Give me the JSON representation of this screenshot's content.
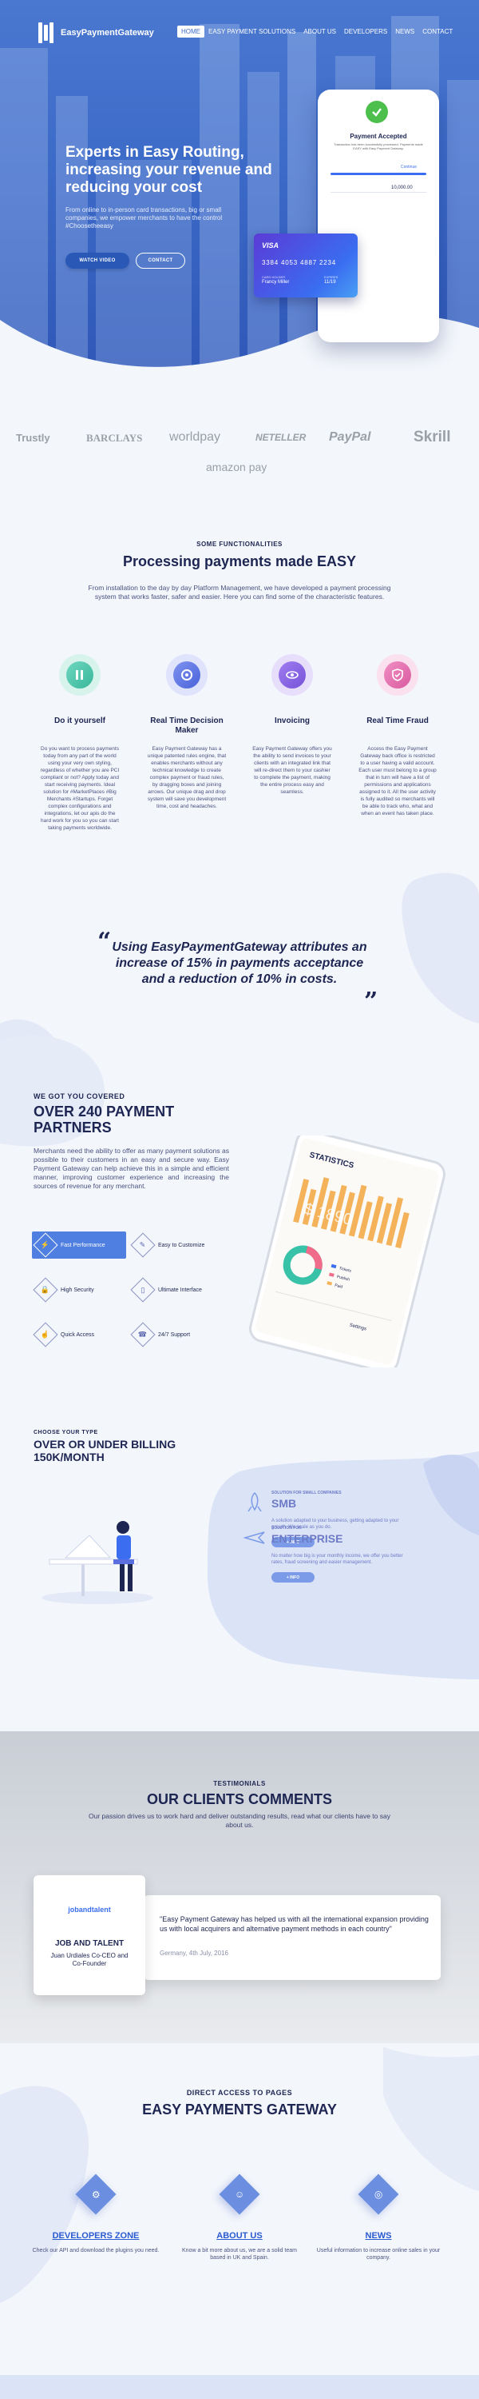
{
  "brand": {
    "name": "EasyPaymentGateway"
  },
  "nav": [
    {
      "label": "HOME",
      "active": true
    },
    {
      "label": "EASY PAYMENT SOLUTIONS"
    },
    {
      "label": "ABOUT US"
    },
    {
      "label": "DEVELOPERS"
    },
    {
      "label": "NEWS"
    },
    {
      "label": "CONTACT"
    }
  ],
  "hero": {
    "title": "Experts in Easy Routing, increasing your revenue and reducing your cost",
    "subtitle": "From online to in-person card transactions, big or small companies, we empower merchants to have the control #Choosetheeasy",
    "watch_label": "WATCH VIDEO",
    "contact_label": "CONTACT",
    "card": {
      "brand": "VISA",
      "number": "3384 4053 4887 2234",
      "holder_label": "CARD HOLDER",
      "holder": "Francy Miller",
      "expiry_label": "EXPIRES",
      "expiry": "11/19"
    },
    "phone": {
      "title": "Payment Accepted",
      "text": "Transaction has been successfully processed. Payments made EASY with Easy Payment Gateway.",
      "link": "Continue",
      "amount": "10,000.00"
    }
  },
  "partners": [
    "Trustly",
    "BARCLAYS",
    "worldpay",
    "NETELLER",
    "PayPal",
    "Skrill",
    "amazon pay"
  ],
  "functionalities": {
    "eyebrow": "SOME FUNCTIONALITIES",
    "title": "Processing payments made EASY",
    "intro": "From installation to the day by day Platform Management, we have developed a payment processing system that works faster, safer and easier. Here you can find some of the characteristic features.",
    "items": [
      {
        "title": "Do it yourself",
        "text": "Do you want to process payments today from any part of the world using your very own styling, regardless of whether you are PCI compliant or not? Apply today and start receiving payments. Ideal solution for #MarketPlaces #Big Merchants #Startups. Forget complex configurations and integrations, let our apis do the hard work for you so you can start taking payments worldwide."
      },
      {
        "title": "Real Time Decision Maker",
        "text": "Easy Payment Gateway has a unique patented rules engine, that enables merchants without any technical knowledge to create complex payment or fraud rules, by dragging boxes and joining arrows. Our unique drag and drop system will save you development time, cost and headaches."
      },
      {
        "title": "Invoicing",
        "text": "Easy Payment Gateway offers you the ability to send invoices to your clients with an integrated link that will re-direct them to your cashier to complete the payment, making the entire process easy and seamless."
      },
      {
        "title": "Real Time Fraud",
        "text": "Access the Easy Payment Gateway back office is restricted to a user having a valid account. Each user must belong to a group that in turn will have a list of permissions and applications assigned to it. All the user activity is fully audited so merchants will be able to track who, what and when an event has taken place."
      }
    ]
  },
  "quote": {
    "text": "Using EasyPaymentGateway attributes an increase of 15% in payments acceptance and a reduction of 10% in costs."
  },
  "covered": {
    "eyebrow": "WE GOT YOU COVERED",
    "title": "OVER 240 PAYMENT PARTNERS",
    "text": "Merchants need the ability to offer as many payment solutions as possible to their customers in an easy and secure way. Easy Payment Gateway can help achieve this in a simple and efficient manner, improving customer experience and increasing the sources of revenue for any merchant.",
    "features": [
      {
        "label": "Fast Performance",
        "active": true
      },
      {
        "label": "Easy to Customize"
      },
      {
        "label": "High Security"
      },
      {
        "label": "Ultimate Interface"
      },
      {
        "label": "Quick Access"
      },
      {
        "label": "24/7 Support"
      }
    ],
    "device": {
      "title": "STATISTICS",
      "amount": "$ 1890",
      "legend": [
        "Tickets",
        "Publish",
        "Paid"
      ],
      "footer": "Settings"
    }
  },
  "billing": {
    "eyebrow": "CHOOSE YOUR TYPE",
    "title": "OVER OR UNDER BILLING 150K/MONTH",
    "plans": [
      {
        "small": "SOLUTION FOR SMALL COMPANIES",
        "title": "SMB",
        "desc": "A solution adapted to your business, getting adapted to your growth. We scale as you do.",
        "button": "+ INFO"
      },
      {
        "small": "SOLUTION FOR",
        "title": "ENTERPRISE",
        "desc": "No matter how big is your monthly income, we offer you better rates, fraud screening and easier management.",
        "button": "+ INFO"
      }
    ]
  },
  "testimonials": {
    "eyebrow": "TESTIMONIALS",
    "title": "OUR CLIENTS COMMENTS",
    "intro": "Our passion drives us to work hard and deliver outstanding results, read what our clients have to say about us.",
    "client": {
      "logo": "jobandtalent",
      "company": "JOB AND TALENT",
      "person": "Juan Urdiales Co-CEO and Co-Founder"
    },
    "comment": "\"Easy Payment Gateway has helped us with all the international expansion providing us with local acquirers and alternative payment methods in each country\"",
    "date": "Germany, 4th July, 2016"
  },
  "access": {
    "eyebrow": "DIRECT ACCESS TO PAGES",
    "title": "EASY PAYMENTS GATEWAY",
    "items": [
      {
        "title": "DEVELOPERS ZONE",
        "text": "Check our API and download the plugins you need."
      },
      {
        "title": "ABOUT US",
        "text": "Know a bit more about us, we are a solid team based in UK and Spain."
      },
      {
        "title": "NEWS",
        "text": "Useful information to increase online sales in your company."
      }
    ]
  }
}
